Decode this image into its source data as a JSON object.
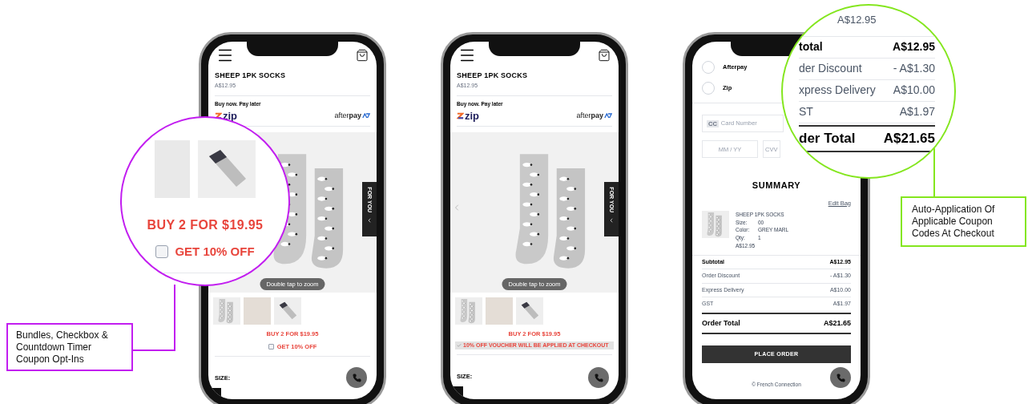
{
  "phones": [
    {
      "kind": "product",
      "title": "SHEEP 1PK SOCKS",
      "price": "A$12.95",
      "pay_later": "Buy now. Pay later",
      "zip": "zip",
      "afterpay": "after**pay**",
      "side_tab": "FOR YOU",
      "zoom_hint": "Double tap to zoom",
      "prev_arrow": false,
      "offer": "BUY 2 FOR $19.95",
      "coupon": {
        "kind": "checkbox",
        "label": "GET 10% OFF",
        "checked": false
      },
      "size_label": "SIZE:"
    },
    {
      "kind": "product",
      "title": "SHEEP 1PK SOCKS",
      "price": "A$12.95",
      "pay_later": "Buy now. Pay later",
      "zip": "zip",
      "afterpay": "after**pay**",
      "side_tab": "FOR YOU",
      "zoom_hint": "Double tap to zoom",
      "prev_arrow": true,
      "offer": "BUY 2 FOR $19.95",
      "coupon": {
        "kind": "applied",
        "label": "10% OFF VOUCHER WILL BE APPLIED AT CHECKOUT",
        "checked": true
      },
      "size_label": "SIZE:"
    },
    {
      "kind": "checkout",
      "payment_options": [
        {
          "label": "Afterpay",
          "selected": false
        },
        {
          "label": "Zip",
          "selected": false
        }
      ],
      "card_badge": "CC",
      "card_placeholder": "Card Number",
      "expiry_placeholder": "MM / YY",
      "cvv_placeholder": "CVV",
      "summary_title": "SUMMARY",
      "edit_link": "Edit Bag",
      "item": {
        "name": "SHEEP 1PK SOCKS",
        "details": [
          {
            "label": "Size:",
            "value": "00"
          },
          {
            "label": "Color:",
            "value": "GREY MARL"
          },
          {
            "label": "Qty:",
            "value": "1"
          }
        ],
        "price": "A$12.95"
      },
      "totals": [
        {
          "kind": "bold",
          "label": "Subtotal",
          "value": "A$12.95"
        },
        {
          "kind": "plain",
          "label": "Order Discount",
          "value": "- A$1.30"
        },
        {
          "kind": "plain",
          "label": "Express Delivery",
          "value": "A$10.00"
        },
        {
          "kind": "plain",
          "label": "GST",
          "value": "A$1.97"
        },
        {
          "kind": "grand",
          "label": "Order Total",
          "value": "A$21.65"
        }
      ],
      "button": "PLACE ORDER",
      "footer": "© French Connection"
    }
  ],
  "magnifiers": [
    {
      "kind": "offer",
      "color": "#c21ef0",
      "offer": "BUY 2 FOR $19.95",
      "coupon": {
        "label": "GET 10% OFF",
        "checked": false
      },
      "callout": "Bundles, Checkbox & Countdown Timer Coupon Opt-Ins"
    },
    {
      "kind": "totals",
      "color": "#84e61e",
      "price": "A$12.95",
      "totals": [
        {
          "kind": "bold",
          "label": "total",
          "value": "A$12.95"
        },
        {
          "kind": "plain",
          "label": "der Discount",
          "value": "- A$1.30"
        },
        {
          "kind": "plain",
          "label": "xpress Delivery",
          "value": "A$10.00"
        },
        {
          "kind": "plain",
          "label": "ST",
          "value": "A$1.97"
        },
        {
          "kind": "grand",
          "label": "der Total",
          "value": "A$21.65"
        }
      ],
      "callout": "Auto-Application Of Applicable Coupon Codes At Checkout"
    }
  ]
}
